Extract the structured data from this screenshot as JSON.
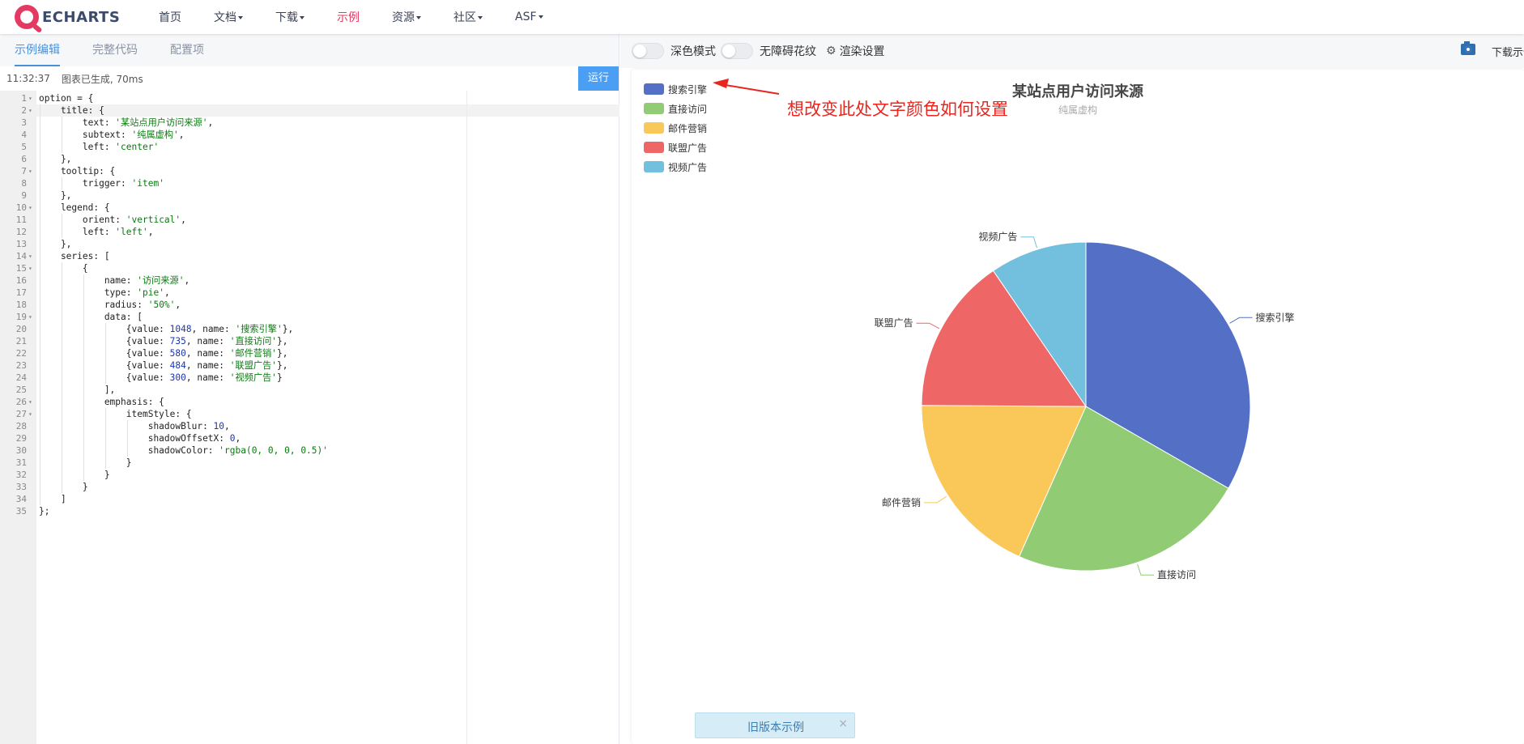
{
  "navbar": {
    "logo_text": "ECHARTS",
    "items": [
      {
        "label": "首页",
        "dropdown": false,
        "active": false
      },
      {
        "label": "文档",
        "dropdown": true,
        "active": false
      },
      {
        "label": "下载",
        "dropdown": true,
        "active": false
      },
      {
        "label": "示例",
        "dropdown": false,
        "active": true
      },
      {
        "label": "资源",
        "dropdown": true,
        "active": false
      },
      {
        "label": "社区",
        "dropdown": true,
        "active": false
      },
      {
        "label": "ASF",
        "dropdown": true,
        "active": false
      }
    ]
  },
  "editor": {
    "tabs": [
      "示例编辑",
      "完整代码",
      "配置项"
    ],
    "active_tab": "示例编辑",
    "status_time": "11:32:37",
    "status_text": "图表已生成, 70ms",
    "run_label": "运行",
    "lines": [
      "option = {",
      "    title: {",
      "        text: '某站点用户访问来源',",
      "        subtext: '纯属虚构',",
      "        left: 'center'",
      "    },",
      "    tooltip: {",
      "        trigger: 'item'",
      "    },",
      "    legend: {",
      "        orient: 'vertical',",
      "        left: 'left',",
      "    },",
      "    series: [",
      "        {",
      "            name: '访问来源',",
      "            type: 'pie',",
      "            radius: '50%',",
      "            data: [",
      "                {value: 1048, name: '搜索引擎'},",
      "                {value: 735, name: '直接访问'},",
      "                {value: 580, name: '邮件营销'},",
      "                {value: 484, name: '联盟广告'},",
      "                {value: 300, name: '视频广告'}",
      "            ],",
      "            emphasis: {",
      "                itemStyle: {",
      "                    shadowBlur: 10,",
      "                    shadowOffsetX: 0,",
      "                    shadowColor: 'rgba(0, 0, 0, 0.5)'",
      "                }",
      "            }",
      "        }",
      "    ]",
      "};"
    ],
    "fold_lines": [
      1,
      2,
      7,
      10,
      14,
      15,
      19,
      26,
      27
    ]
  },
  "toolbar": {
    "dark_mode_label": "深色模式",
    "aria_label": "无障碍花纹",
    "render_settings_label": "渲染设置",
    "download_label": "下载示例",
    "camera_icon": "camera-icon",
    "gear_icon": "gear-icon"
  },
  "annotation": {
    "text": "想改变此处文字颜色如何设置",
    "color": "#e8251f"
  },
  "old_version": {
    "label": "旧版本示例",
    "close": "×"
  },
  "chart_data": {
    "type": "pie",
    "title": "某站点用户访问来源",
    "subtitle": "纯属虚构",
    "legend_position": "top-left",
    "legend_orient": "vertical",
    "series_name": "访问来源",
    "slices": [
      {
        "name": "搜索引擎",
        "value": 1048,
        "color": "#5470c6"
      },
      {
        "name": "直接访问",
        "value": 735,
        "color": "#91cc75"
      },
      {
        "name": "邮件营销",
        "value": 580,
        "color": "#fac858"
      },
      {
        "name": "联盟广告",
        "value": 484,
        "color": "#ee6666"
      },
      {
        "name": "视频广告",
        "value": 300,
        "color": "#73c0de"
      }
    ]
  }
}
